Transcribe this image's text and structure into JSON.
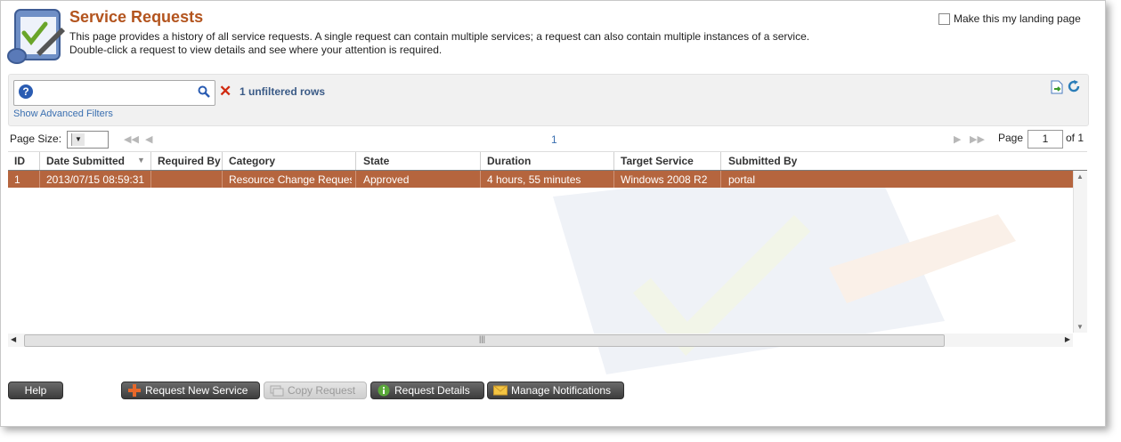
{
  "header": {
    "title": "Service Requests",
    "description_line1": "This page provides a history of all service requests. A single request can contain multiple services; a request can also contain multiple instances of a service.",
    "description_line2": "Double-click a request to view details and see where your attention is required.",
    "landing_label": "Make this my landing page",
    "landing_checked": false
  },
  "filter": {
    "search_value": "",
    "unfiltered_text": "1 unfiltered rows",
    "advanced_link": "Show Advanced Filters"
  },
  "pager": {
    "page_size_label": "Page Size:",
    "page_size_value": "20",
    "current_page_link": "1",
    "page_label": "Page",
    "page_input": "1",
    "of_label": "of 1"
  },
  "grid": {
    "columns": [
      "ID",
      "Date Submitted",
      "Required By",
      "Category",
      "State",
      "Duration",
      "Target Service",
      "Submitted By"
    ],
    "sort_column": "Date Submitted",
    "rows": [
      {
        "id": "1",
        "date_submitted": "2013/07/15 08:59:31",
        "required_by": "",
        "category": "Resource Change Request",
        "state": "Approved",
        "duration": "4 hours, 55 minutes",
        "target_service": "Windows 2008 R2",
        "submitted_by": "portal"
      }
    ],
    "selected_row_color": "#b5653e"
  },
  "buttons": {
    "help": "Help",
    "request_new": "Request New Service",
    "copy_request": "Copy Request",
    "request_details": "Request Details",
    "manage_notifications": "Manage Notifications"
  },
  "colors": {
    "title": "#b3541e",
    "link": "#3a6fb0",
    "accent_row": "#b5653e"
  }
}
